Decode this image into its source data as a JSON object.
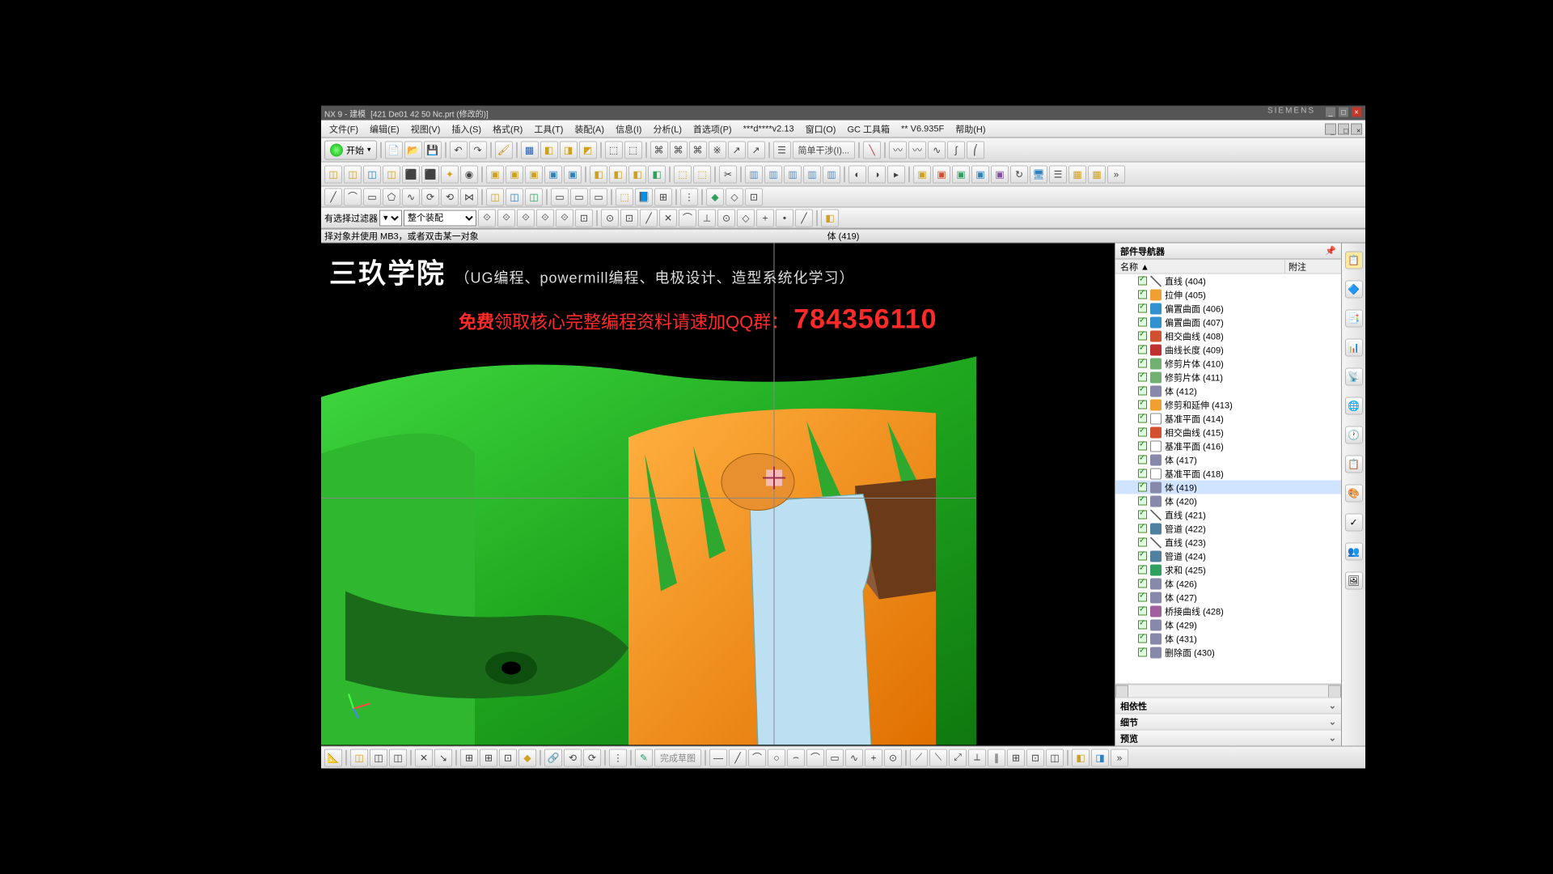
{
  "title_prefix": "NX 9 - 建模",
  "title_doc": "[421 De01 42 50 Nc.prt (修改的)]",
  "brand": "SIEMENS",
  "menus": [
    "文件(F)",
    "编辑(E)",
    "视图(V)",
    "插入(S)",
    "格式(R)",
    "工具(T)",
    "装配(A)",
    "信息(I)",
    "分析(L)",
    "首选项(P)",
    "***d****v2.13",
    "窗口(O)",
    "GC 工具箱",
    "** V6.935F",
    "帮助(H)"
  ],
  "start_label": "开始",
  "filter_label": "有选择过滤器",
  "filter_value": "整个装配",
  "quick_interf": "简单干涉(I)...",
  "statusbar_left": "择对象并使用 MB3，或者双击某一对象",
  "statusbar_center": "体 (419)",
  "overlay": {
    "title": "三玖学院",
    "subtitle": "（UG编程、powermill编程、电极设计、造型系统化学习）",
    "line2a": "免费",
    "line2b": "领取核心完整编程资料请速加QQ群：",
    "qq": "784356110"
  },
  "nav": {
    "title": "部件导航器",
    "col_name": "名称 ▲",
    "col_note": "附注",
    "sec_dep": "相依性",
    "sec_det": "细节",
    "sec_prev": "预览"
  },
  "sketch_done": "完成草图",
  "tree": [
    {
      "icon": "ic-line",
      "label": "直线 (404)"
    },
    {
      "icon": "ic-ext",
      "label": "拉伸 (405)"
    },
    {
      "icon": "ic-ovr",
      "label": "偏置曲面 (406)"
    },
    {
      "icon": "ic-ovr",
      "label": "偏置曲面 (407)"
    },
    {
      "icon": "ic-int",
      "label": "相交曲线 (408)"
    },
    {
      "icon": "ic-len",
      "label": "曲线长度 (409)"
    },
    {
      "icon": "ic-trim",
      "label": "修剪片体 (410)"
    },
    {
      "icon": "ic-trim",
      "label": "修剪片体 (411)"
    },
    {
      "icon": "ic-body",
      "label": "体 (412)"
    },
    {
      "icon": "ic-ext",
      "label": "修剪和延伸 (413)"
    },
    {
      "icon": "ic-dat",
      "label": "基准平面 (414)"
    },
    {
      "icon": "ic-int",
      "label": "相交曲线 (415)"
    },
    {
      "icon": "ic-dat",
      "label": "基准平面 (416)"
    },
    {
      "icon": "ic-body",
      "label": "体 (417)"
    },
    {
      "icon": "ic-dat",
      "label": "基准平面 (418)"
    },
    {
      "icon": "ic-body",
      "label": "体 (419)",
      "sel": true
    },
    {
      "icon": "ic-body",
      "label": "体 (420)"
    },
    {
      "icon": "ic-line",
      "label": "直线 (421)"
    },
    {
      "icon": "ic-tube",
      "label": "管道 (422)"
    },
    {
      "icon": "ic-line",
      "label": "直线 (423)"
    },
    {
      "icon": "ic-tube",
      "label": "管道 (424)"
    },
    {
      "icon": "ic-sum",
      "label": "求和 (425)"
    },
    {
      "icon": "ic-body",
      "label": "体 (426)"
    },
    {
      "icon": "ic-body",
      "label": "体 (427)"
    },
    {
      "icon": "ic-brg",
      "label": "桥接曲线 (428)"
    },
    {
      "icon": "ic-body",
      "label": "体 (429)"
    },
    {
      "icon": "ic-body",
      "label": "体 (431)"
    },
    {
      "icon": "ic-body",
      "label": "删除面 (430)"
    }
  ]
}
